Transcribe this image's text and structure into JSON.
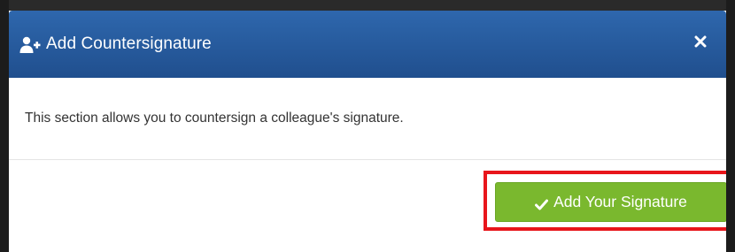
{
  "modal": {
    "title": "Add Countersignature",
    "header_icon": "user-plus-icon",
    "close_icon": "close-icon",
    "body_text": "This section allows you to countersign a colleague's signature.",
    "primary_button_label": "Add Your Signature",
    "primary_button_icon": "check-icon",
    "header_color": "#2a5c9e",
    "button_color": "#7ab82e",
    "highlight_color": "#e8151b"
  }
}
